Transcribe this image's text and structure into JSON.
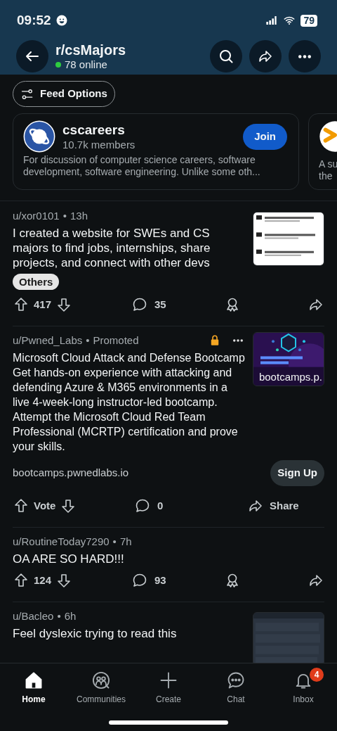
{
  "status_bar": {
    "time": "09:52",
    "battery": "79"
  },
  "header": {
    "title": "r/csMajors",
    "online": "78 online"
  },
  "feed_options": {
    "label": "Feed Options"
  },
  "communities": [
    {
      "name": "cscareers",
      "members": "10.7k members",
      "description": "For discussion of computer science careers, software development, software engineering.  Unlike some oth...",
      "button": "Join"
    },
    {
      "description_lines": [
        "A su",
        "the"
      ]
    }
  ],
  "posts": [
    {
      "kind": "post",
      "author": "u/xor0101",
      "separator": "•",
      "time": "13h",
      "title": "I created a website for SWEs and CS majors to find jobs, internships, share projects, and connect with other devs",
      "flair": "Others",
      "votes": "417",
      "comments": "35"
    },
    {
      "kind": "promoted",
      "author": "u/Pwned_Labs",
      "separator": "•",
      "time": "Promoted",
      "title": "Microsoft Cloud Attack and Defense Bootcamp Get hands-on experience with attacking and defending Azure & M365 environments in a live 4-week-long instructor-led bootcamp. Attempt the Microsoft Cloud Red Team Professional (MCRTP) certification and prove your skills.",
      "thumbnail": {
        "kind": "picture",
        "caption": "bootcamps.p."
      },
      "domain": "bootcamps.pwnedlabs.io",
      "cta": "Sign Up",
      "votes": "Vote",
      "comments": "0",
      "share": "Share"
    },
    {
      "kind": "post",
      "author": "u/RoutineToday7290",
      "separator": "•",
      "time": "7h",
      "title": "OA ARE SO HARD!!!",
      "votes": "124",
      "comments": "93"
    },
    {
      "kind": "post",
      "author": "u/Bacleo",
      "separator": "•",
      "time": "6h",
      "title": "Feel dyslexic trying to read this"
    }
  ],
  "nav": [
    {
      "label": "Home",
      "selected": true
    },
    {
      "label": "Communities",
      "selected": false
    },
    {
      "label": "Create",
      "selected": false
    },
    {
      "label": "Chat",
      "selected": false
    },
    {
      "label": "Inbox",
      "selected": false,
      "badge": "4"
    }
  ]
}
